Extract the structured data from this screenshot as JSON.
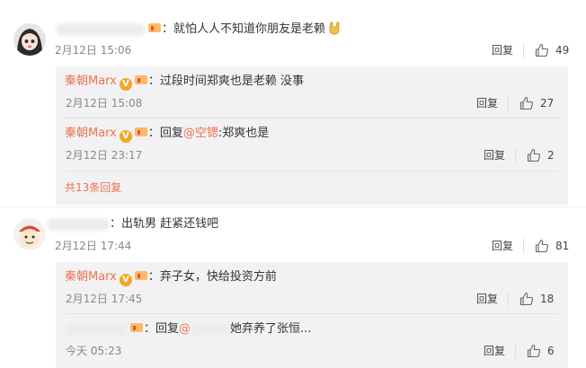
{
  "comments": [
    {
      "text": "：就怕人人不知道你朋友是老赖",
      "time": "2月12日 15:06",
      "reply_label": "回复",
      "likes": "49",
      "replies": [
        {
          "name": "秦朝Marx",
          "text": "：过段时间郑爽也是老赖 没事",
          "time": "2月12日 15:08",
          "reply_label": "回复",
          "likes": "27"
        },
        {
          "name": "秦朝Marx",
          "prefix": "：回复",
          "mention": "@空锶",
          "text": ":郑爽也是",
          "time": "2月12日 23:17",
          "reply_label": "回复",
          "likes": "2"
        }
      ],
      "more_label": "共13条回复"
    },
    {
      "text": "：出轨男  赶紧还钱吧",
      "time": "2月12日 17:44",
      "reply_label": "回复",
      "likes": "81",
      "replies": [
        {
          "name": "秦朝Marx",
          "text": "：弃子女，快给投资方前",
          "time": "2月12日 17:45",
          "reply_label": "回复",
          "likes": "18"
        },
        {
          "prefix": "：回复",
          "mention": "@",
          "text": "她弃养了张恒...",
          "time": "今天 05:23",
          "reply_label": "回复",
          "likes": "6"
        }
      ]
    }
  ],
  "colors": {
    "accent": "#eb7350",
    "panel": "#f2f2f5",
    "meta": "#888888"
  },
  "icons": [
    "rock-hand-emoji",
    "thumbs-up-icon",
    "verified-v-badge",
    "level-badge-icon"
  ]
}
